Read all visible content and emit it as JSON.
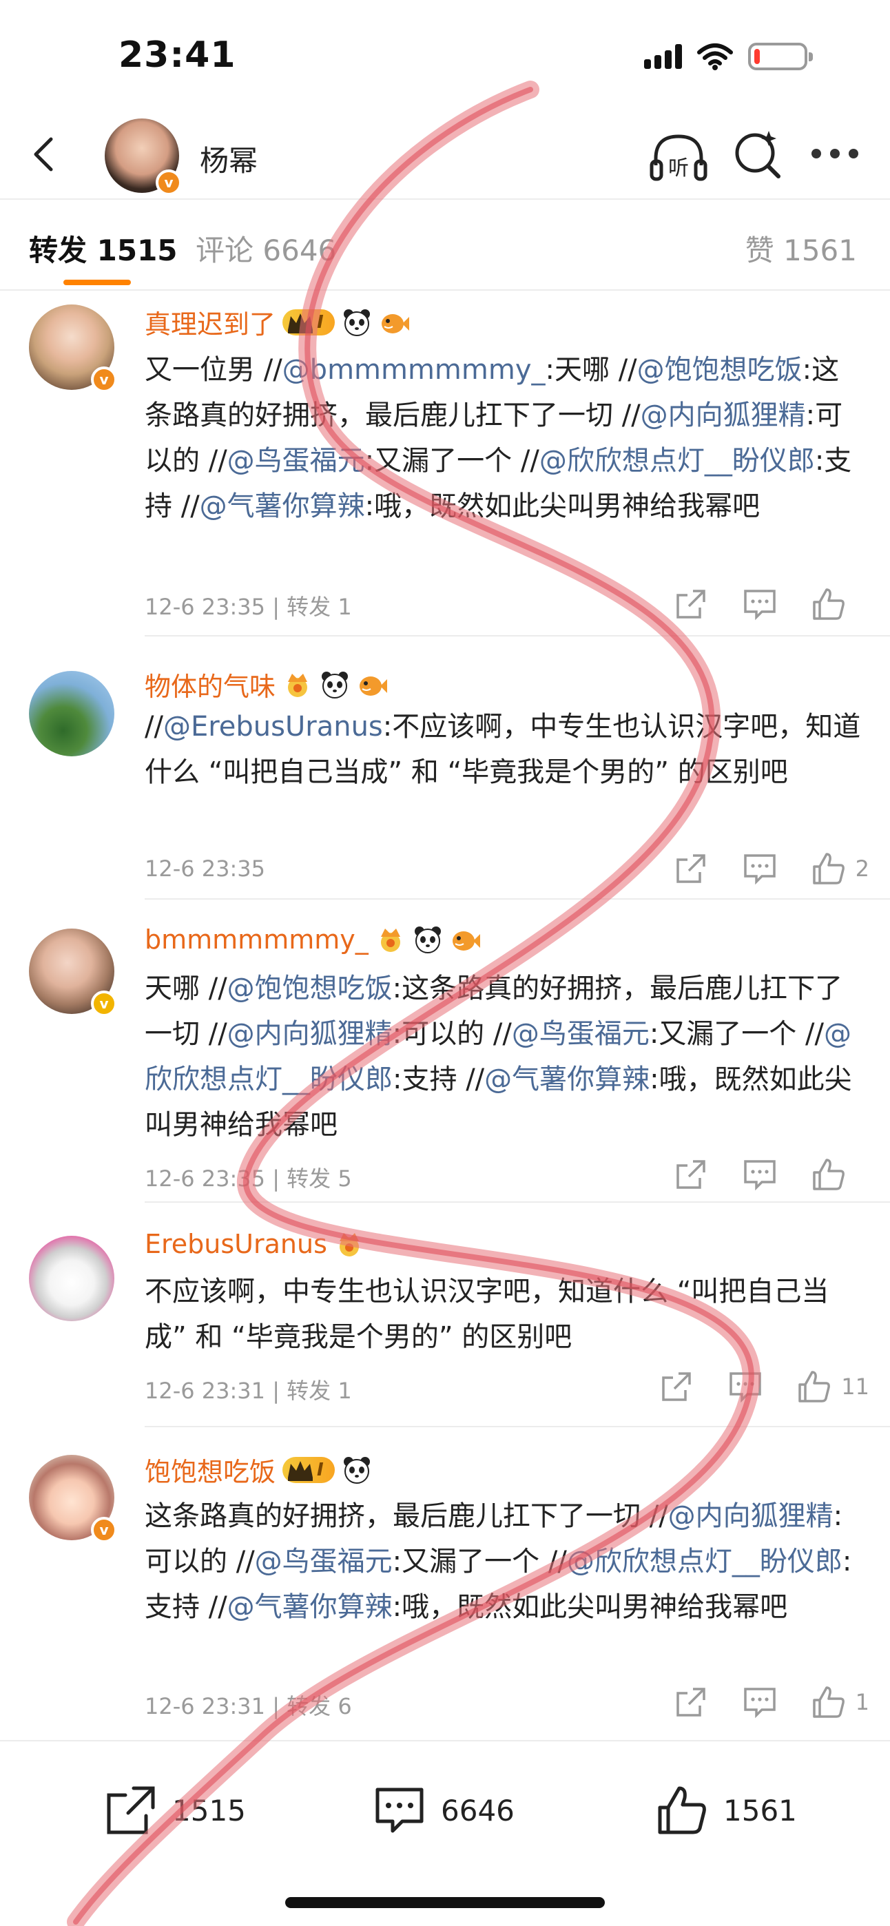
{
  "status_bar": {
    "time": "23:41",
    "battery_level": 0.12
  },
  "header": {
    "title": "杨幂",
    "listen_icon": "listen-headphones-icon",
    "search_icon": "super-search-icon",
    "more_icon": "more-icon"
  },
  "tabs": {
    "repost": {
      "label": "转发",
      "count": "1515"
    },
    "comment": {
      "label": "评论",
      "count": "6646"
    },
    "like": {
      "label": "赞",
      "count": "1561"
    }
  },
  "items": [
    {
      "name": "真理迟到了",
      "badges": [
        "vip-crown",
        "panda",
        "fish"
      ],
      "text_parts": [
        {
          "t": "又一位男 //",
          "m": false
        },
        {
          "t": "@bmmmmmmmy_",
          "m": true
        },
        {
          "t": ":天哪 //",
          "m": false
        },
        {
          "t": "@饱饱想吃饭",
          "m": true
        },
        {
          "t": ":这条路真的好拥挤，最后鹿儿扛下了一切 //",
          "m": false
        },
        {
          "t": "@内向狐狸精",
          "m": true
        },
        {
          "t": ":可以的 //",
          "m": false
        },
        {
          "t": "@鸟蛋福元",
          "m": true
        },
        {
          "t": ":又漏了一个 //",
          "m": false
        },
        {
          "t": "@欣欣想点灯__盼仪郎",
          "m": true
        },
        {
          "t": ":支持 //",
          "m": false
        },
        {
          "t": "@气薯你算辣",
          "m": true
        },
        {
          "t": ":哦，既然如此尖叫男神给我幂吧",
          "m": false
        }
      ],
      "time": "12-6 23:35",
      "repost": "转发 1",
      "likes": ""
    },
    {
      "name": "物体的气味",
      "badges": [
        "sun-crown",
        "panda",
        "fish"
      ],
      "text_parts": [
        {
          "t": "//",
          "m": false
        },
        {
          "t": "@ErebusUranus",
          "m": true
        },
        {
          "t": ":不应该啊，中专生也认识汉字吧，知道什么 “叫把自己当成” 和 “毕竟我是个男的” 的区别吧",
          "m": false
        }
      ],
      "time": "12-6 23:35",
      "repost": "",
      "likes": "2"
    },
    {
      "name": "bmmmmmmmy_",
      "badges": [
        "sun-crown",
        "panda",
        "fish"
      ],
      "text_parts": [
        {
          "t": "天哪 //",
          "m": false
        },
        {
          "t": "@饱饱想吃饭",
          "m": true
        },
        {
          "t": ":这条路真的好拥挤，最后鹿儿扛下了一切 //",
          "m": false
        },
        {
          "t": "@内向狐狸精",
          "m": true
        },
        {
          "t": ":可以的 //",
          "m": false
        },
        {
          "t": "@鸟蛋福元",
          "m": true
        },
        {
          "t": ":又漏了一个 //",
          "m": false
        },
        {
          "t": "@欣欣想点灯__盼仪郎",
          "m": true
        },
        {
          "t": ":支持 //",
          "m": false
        },
        {
          "t": "@气薯你算辣",
          "m": true
        },
        {
          "t": ":哦，既然如此尖叫男神给我幂吧",
          "m": false
        }
      ],
      "time": "12-6 23:35",
      "repost": "转发 5",
      "likes": ""
    },
    {
      "name": "ErebusUranus",
      "badges": [
        "sun-crown"
      ],
      "text_parts": [
        {
          "t": "不应该啊，中专生也认识汉字吧，知道什么 “叫把自己当成” 和 “毕竟我是个男的” 的区别吧",
          "m": false
        }
      ],
      "time": "12-6 23:31",
      "repost": "转发 1",
      "likes": "11"
    },
    {
      "name": "饱饱想吃饭",
      "badges": [
        "vip-crown",
        "panda"
      ],
      "text_parts": [
        {
          "t": "这条路真的好拥挤，最后鹿儿扛下了一切 //",
          "m": false
        },
        {
          "t": "@内向狐狸精",
          "m": true
        },
        {
          "t": ":可以的 //",
          "m": false
        },
        {
          "t": "@鸟蛋福元",
          "m": true
        },
        {
          "t": ":又漏了一个 //",
          "m": false
        },
        {
          "t": "@欣欣想点灯__盼仪郎",
          "m": true
        },
        {
          "t": ":支持 //",
          "m": false
        },
        {
          "t": "@气薯你算辣",
          "m": true
        },
        {
          "t": ":哦，既然如此尖叫男神给我幂吧",
          "m": false
        }
      ],
      "time": "12-6 23:31",
      "repost": "转发 6",
      "likes": "1"
    }
  ],
  "vip_tag_text": "I",
  "bottom_bar": {
    "repost_count": "1515",
    "comment_count": "6646",
    "like_count": "1561"
  },
  "colors": {
    "accent": "#ff8200",
    "username": "#e8681a",
    "mention": "#4b6a96",
    "scribble": "#e8727a"
  }
}
